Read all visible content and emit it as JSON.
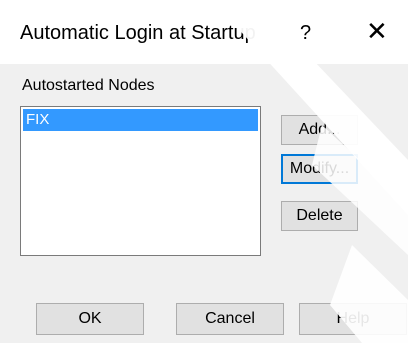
{
  "window": {
    "title": "Automatic Login at Startup",
    "help_glyph": "?",
    "close_glyph": "✕"
  },
  "nodes_group": {
    "label": "Autostarted Nodes",
    "items": [
      "FIX"
    ],
    "selected_index": 0
  },
  "side_buttons": {
    "add": "Add...",
    "modify": "Modify...",
    "delete": "Delete"
  },
  "bottom_buttons": {
    "ok": "OK",
    "cancel": "Cancel",
    "help": "Help"
  },
  "colors": {
    "selection": "#3399ff",
    "focus_border": "#0078d7",
    "dialog_bg": "#f0f0f0"
  }
}
